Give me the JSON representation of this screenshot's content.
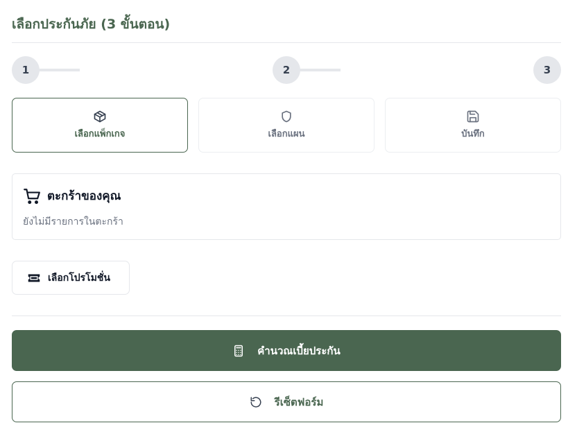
{
  "header": {
    "title": "เลือกประกันภัย (3 ขั้นตอน)"
  },
  "stepper": {
    "steps": [
      {
        "number": "1"
      },
      {
        "number": "2"
      },
      {
        "number": "3"
      }
    ]
  },
  "step_cards": [
    {
      "label": "เลือกแพ็กเกจ",
      "icon": "package-icon",
      "active": true
    },
    {
      "label": "เลือกแผน",
      "icon": "shield-icon",
      "active": false
    },
    {
      "label": "บันทึก",
      "icon": "save-icon",
      "active": false
    }
  ],
  "cart": {
    "title": "ตะกร้าของคุณ",
    "empty_text": "ยังไม่มีรายการในตะกร้า",
    "icon": "shopping-cart-icon"
  },
  "promotion": {
    "label": "เลือกโปรโมชั่น",
    "icon": "ticket-icon"
  },
  "actions": {
    "calculate_label": "คำนวณเบี้ยประกัน",
    "calculate_icon": "calculator-icon",
    "reset_label": "รีเซ็ตฟอร์ม",
    "reset_icon": "reset-icon"
  },
  "colors": {
    "primary": "#4a6650",
    "border": "#e5e7eb",
    "muted_text": "#6b7280"
  }
}
